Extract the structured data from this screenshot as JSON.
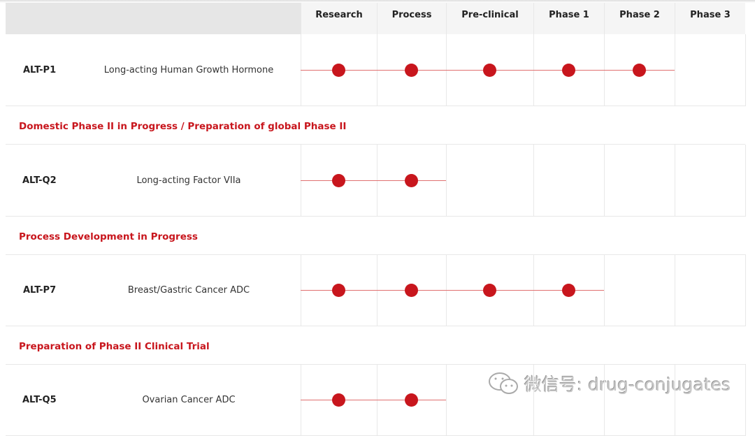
{
  "header": {
    "phases": [
      "Research",
      "Process",
      "Pre-clinical",
      "Phase 1",
      "Phase 2",
      "Phase 3"
    ]
  },
  "pipeline": [
    {
      "code": "ALT-P1",
      "name": "Long-acting Human Growth Hormone",
      "stages_completed": 5,
      "status": "Domestic Phase II in Progress / Preparation of global Phase II"
    },
    {
      "code": "ALT-Q2",
      "name": "Long-acting Factor VIIa",
      "stages_completed": 2,
      "status": "Process Development in Progress"
    },
    {
      "code": "ALT-P7",
      "name": "Breast/Gastric Cancer ADC",
      "stages_completed": 4,
      "status": "Preparation of Phase II Clinical Trial"
    },
    {
      "code": "ALT-Q5",
      "name": "Ovarian Cancer ADC",
      "stages_completed": 2
    }
  ],
  "watermark": {
    "icon": "wechat-icon",
    "text": "微信号: drug-conjugates"
  },
  "colors": {
    "accent": "#c8161d",
    "header_bg": "#e6e6e6"
  }
}
